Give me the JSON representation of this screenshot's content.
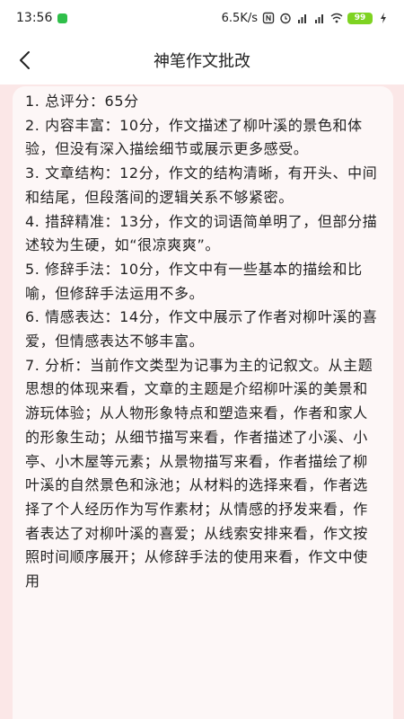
{
  "status_bar": {
    "time": "13:56",
    "network_speed": "6.5K/s",
    "battery_level": "99",
    "app_indicator_color": "#2fbf4a",
    "icons": [
      "nfc-icon",
      "alarm-icon",
      "hd-signal-icon",
      "hd-signal-icon",
      "wifi-icon",
      "battery-icon",
      "charging-icon"
    ]
  },
  "header": {
    "title": "神笔作文批改",
    "back_icon": "chevron-left-icon"
  },
  "content": {
    "text": "1. 总评分：65分\n2. 内容丰富：10分，作文描述了柳叶溪的景色和体验，但没有深入描绘细节或展示更多感受。\n3. 文章结构：12分，作文的结构清晰，有开头、中间和结尾，但段落间的逻辑关系不够紧密。\n4. 措辞精准：13分，作文的词语简单明了，但部分描述较为生硬，如“很凉爽爽”。\n5. 修辞手法：10分，作文中有一些基本的描绘和比喻，但修辞手法运用不多。\n6. 情感表达：14分，作文中展示了作者对柳叶溪的喜爱，但情感表达不够丰富。\n7. 分析：当前作文类型为记事为主的记叙文。从主题思想的体现来看，文章的主题是介绍柳叶溪的美景和游玩体验；从人物形象特点和塑造来看，作者和家人的形象生动；从细节描写来看，作者描述了小溪、小亭、小木屋等元素；从景物描写来看，作者描绘了柳叶溪的自然景色和泳池；从材料的选择来看，作者选择了个人经历作为写作素材；从情感的抒发来看，作者表达了对柳叶溪的喜爱；从线索安排来看，作文按照时间顺序展开；从修辞手法的使用来看，作文中使用"
  },
  "colors": {
    "page_background": "#fbe7e7",
    "card_background": "#fdf7f7",
    "text": "#222222"
  }
}
